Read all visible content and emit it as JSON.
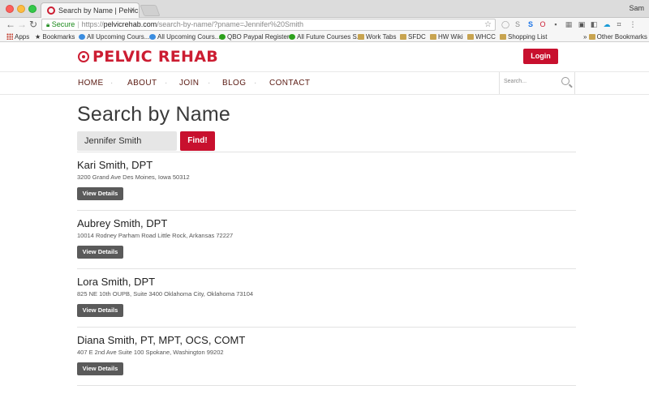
{
  "browser": {
    "tab_title": "Search by Name | Pelvic Rehab",
    "user": "Sam",
    "secure_label": "Secure",
    "url_scheme": "https://",
    "url_host": "pelvicrehab.com",
    "url_path": "/search-by-name/?pname=Jennifer%20Smith",
    "bookmarks": [
      {
        "label": "Apps",
        "icon": "apps-icon"
      },
      {
        "label": "Bookmarks",
        "icon": "star-icon"
      },
      {
        "label": "All Upcoming Cours...",
        "icon": "globe-icon"
      },
      {
        "label": "All Upcoming Cours...",
        "icon": "globe-icon"
      },
      {
        "label": "QBO Paypal Register",
        "icon": "qbo-icon"
      },
      {
        "label": "All Future Courses S...",
        "icon": "qbo-icon"
      },
      {
        "label": "Work Tabs",
        "icon": "folder-icon"
      },
      {
        "label": "SFDC",
        "icon": "folder-icon"
      },
      {
        "label": "HW Wiki",
        "icon": "folder-icon"
      },
      {
        "label": "WHCC",
        "icon": "folder-icon"
      },
      {
        "label": "Shopping List",
        "icon": "folder-icon"
      }
    ],
    "other_bookmarks": "Other Bookmarks"
  },
  "header": {
    "logo_text": "PELVIC REHAB",
    "login_label": "Login",
    "brand_color": "#c8102e"
  },
  "nav": {
    "items": [
      "HOME",
      "ABOUT",
      "JOIN",
      "BLOG",
      "CONTACT"
    ],
    "search_placeholder": "Search..."
  },
  "main": {
    "title": "Search by Name",
    "search_value": "Jennifer Smith",
    "find_label": "Find!",
    "details_label": "View Details",
    "results": [
      {
        "name": "Kari Smith, DPT",
        "address": "3200 Grand Ave Des Moines, Iowa 50312"
      },
      {
        "name": "Aubrey Smith, DPT",
        "address": "10014 Rodney Parham Road Little Rock, Arkansas 72227"
      },
      {
        "name": "Lora Smith, DPT",
        "address": "825 NE 10th OUPB, Suite 3400 Oklahoma City, Oklahoma 73104"
      },
      {
        "name": "Diana Smith, PT, MPT, OCS, COMT",
        "address": "407 E 2nd Ave Suite 100 Spokane, Washington 99202"
      }
    ]
  }
}
